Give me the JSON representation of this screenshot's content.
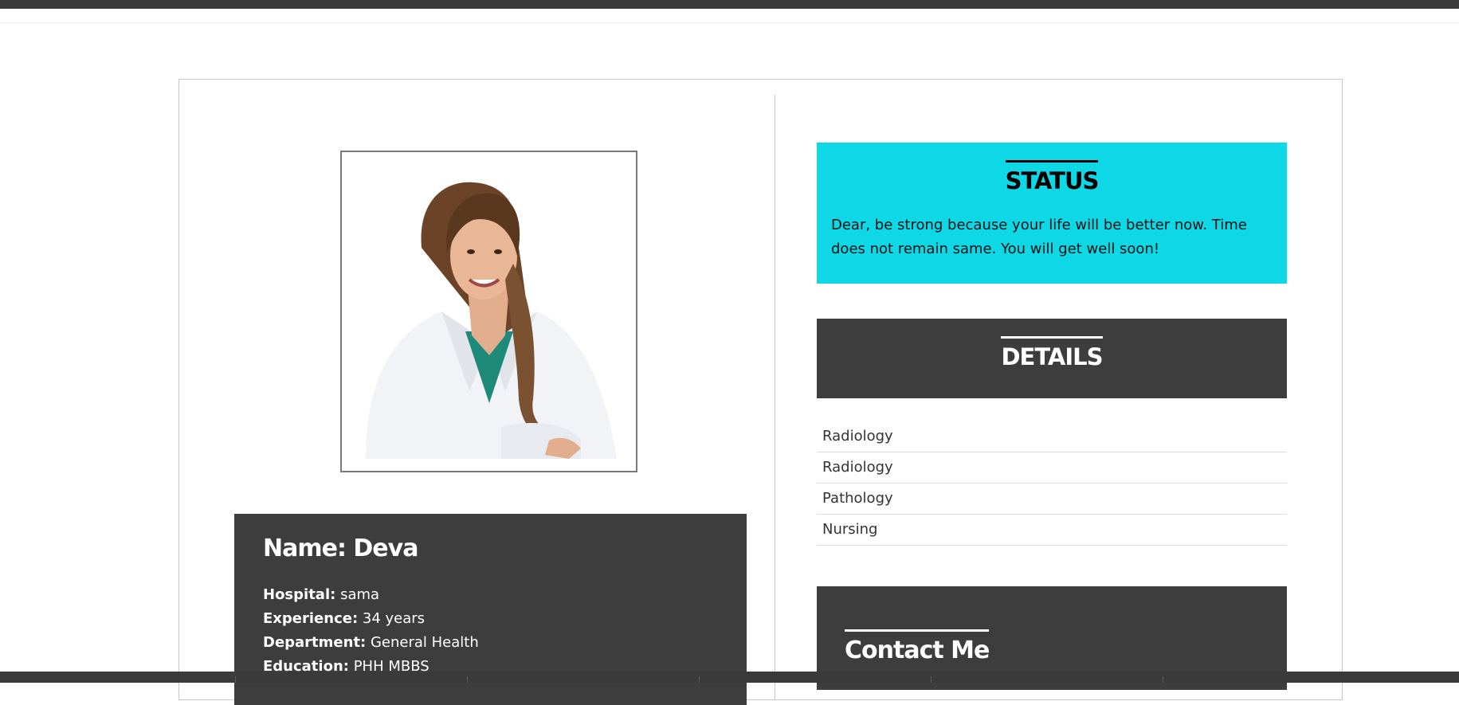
{
  "profile": {
    "name_label": "Name: Deva",
    "rows": [
      {
        "label": "Hospital:",
        "value": "sama"
      },
      {
        "label": "Experience:",
        "value": "34 years"
      },
      {
        "label": "Department:",
        "value": "General Health"
      },
      {
        "label": "Education:",
        "value": "PHH MBBS"
      }
    ]
  },
  "status": {
    "title": "STATUS",
    "message": "Dear, be strong because your life will be better now. Time does not remain same. You will get well soon!"
  },
  "details": {
    "title": "DETAILS",
    "items": [
      "Radiology",
      "Radiology",
      "Pathology",
      "Nursing"
    ]
  },
  "contact": {
    "title": "Contact Me"
  },
  "colors": {
    "status_bg": "#0fd8e6",
    "dark_panel": "#3d3d3d"
  }
}
